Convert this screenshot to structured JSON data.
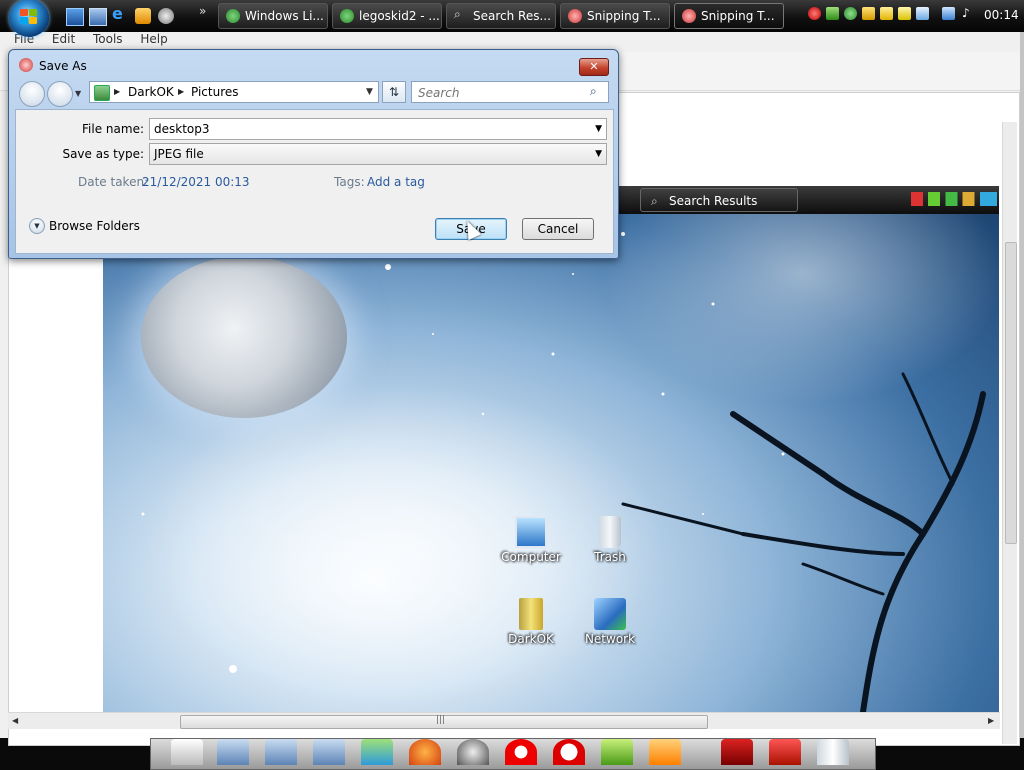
{
  "taskbar": {
    "buttons": [
      {
        "label": "Windows Li...",
        "icon": "messenger-icon",
        "active": false
      },
      {
        "label": "legoskid2 - ...",
        "icon": "messenger-icon",
        "active": false
      },
      {
        "label": "Search Res...",
        "icon": "search-icon",
        "active": false
      },
      {
        "label": "Snipping T...",
        "icon": "snipping-tool-icon",
        "active": false
      },
      {
        "label": "Snipping T...",
        "icon": "snipping-tool-icon",
        "active": true
      }
    ],
    "quicklaunch_more": "»",
    "clock": "00:14"
  },
  "app": {
    "menu": [
      "File",
      "Edit",
      "Tools",
      "Help"
    ]
  },
  "screenshot": {
    "taskbar_button": "Search Results",
    "desktop_icons": [
      {
        "label": "Computer",
        "icon": "computer-icon"
      },
      {
        "label": "Trash",
        "icon": "trash-icon"
      },
      {
        "label": "DarkOK",
        "icon": "user-folder-icon"
      },
      {
        "label": "Network",
        "icon": "network-icon"
      }
    ]
  },
  "dialog": {
    "title": "Save As",
    "close_label": "✕",
    "breadcrumb": [
      "DarkOK",
      "Pictures"
    ],
    "search_placeholder": "Search",
    "file_name_label": "File name:",
    "file_name_value": "desktop3",
    "save_type_label": "Save as type:",
    "save_type_value": "JPEG file",
    "date_label": "Date taken:",
    "date_value": "21/12/2021 00:13",
    "tags_label": "Tags:",
    "tags_value": "Add a tag",
    "browse_label": "Browse Folders",
    "save_label": "Save",
    "cancel_label": "Cancel"
  },
  "colors": {
    "dialog_frame": "#a7c4e6",
    "link_blue": "#2a5aa0",
    "taskbar": "#111111"
  }
}
